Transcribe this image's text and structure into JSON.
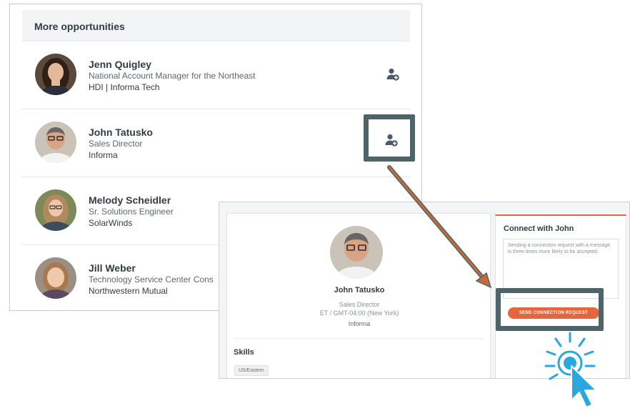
{
  "opportunities": {
    "heading": "More opportunities",
    "people": [
      {
        "name": "Jenn Quigley",
        "title": "National Account Manager for the Northeast",
        "company": "HDI | Informa Tech"
      },
      {
        "name": "John Tatusko",
        "title": "Sales Director",
        "company": "Informa"
      },
      {
        "name": "Melody Scheidler",
        "title": "Sr. Solutions Engineer",
        "company": "SolarWinds"
      },
      {
        "name": "Jill Weber",
        "title": "Technology Service Center Cons",
        "company": "Northwestern Mutual"
      }
    ]
  },
  "profile": {
    "name": "John Tatusko",
    "title": "Sales Director",
    "timezone": "ET / GMT-04:00 (New York)",
    "company": "Informa",
    "skills_heading": "Skills",
    "skills": [
      "US/Eastern"
    ]
  },
  "connect": {
    "title": "Connect with John",
    "message_placeholder": "Sending a connection request with a message is three times more likely to be accepted.",
    "send_label": "SEND CONNECTION REQUEST"
  },
  "icons": {
    "add_connection": "add-person-icon",
    "click_cursor": "cursor-click-icon"
  },
  "colors": {
    "accent_orange": "#e8643c",
    "highlight_frame": "#4f6468",
    "arrow": "#c46a3a",
    "cursor_blue": "#2aa7e0"
  }
}
